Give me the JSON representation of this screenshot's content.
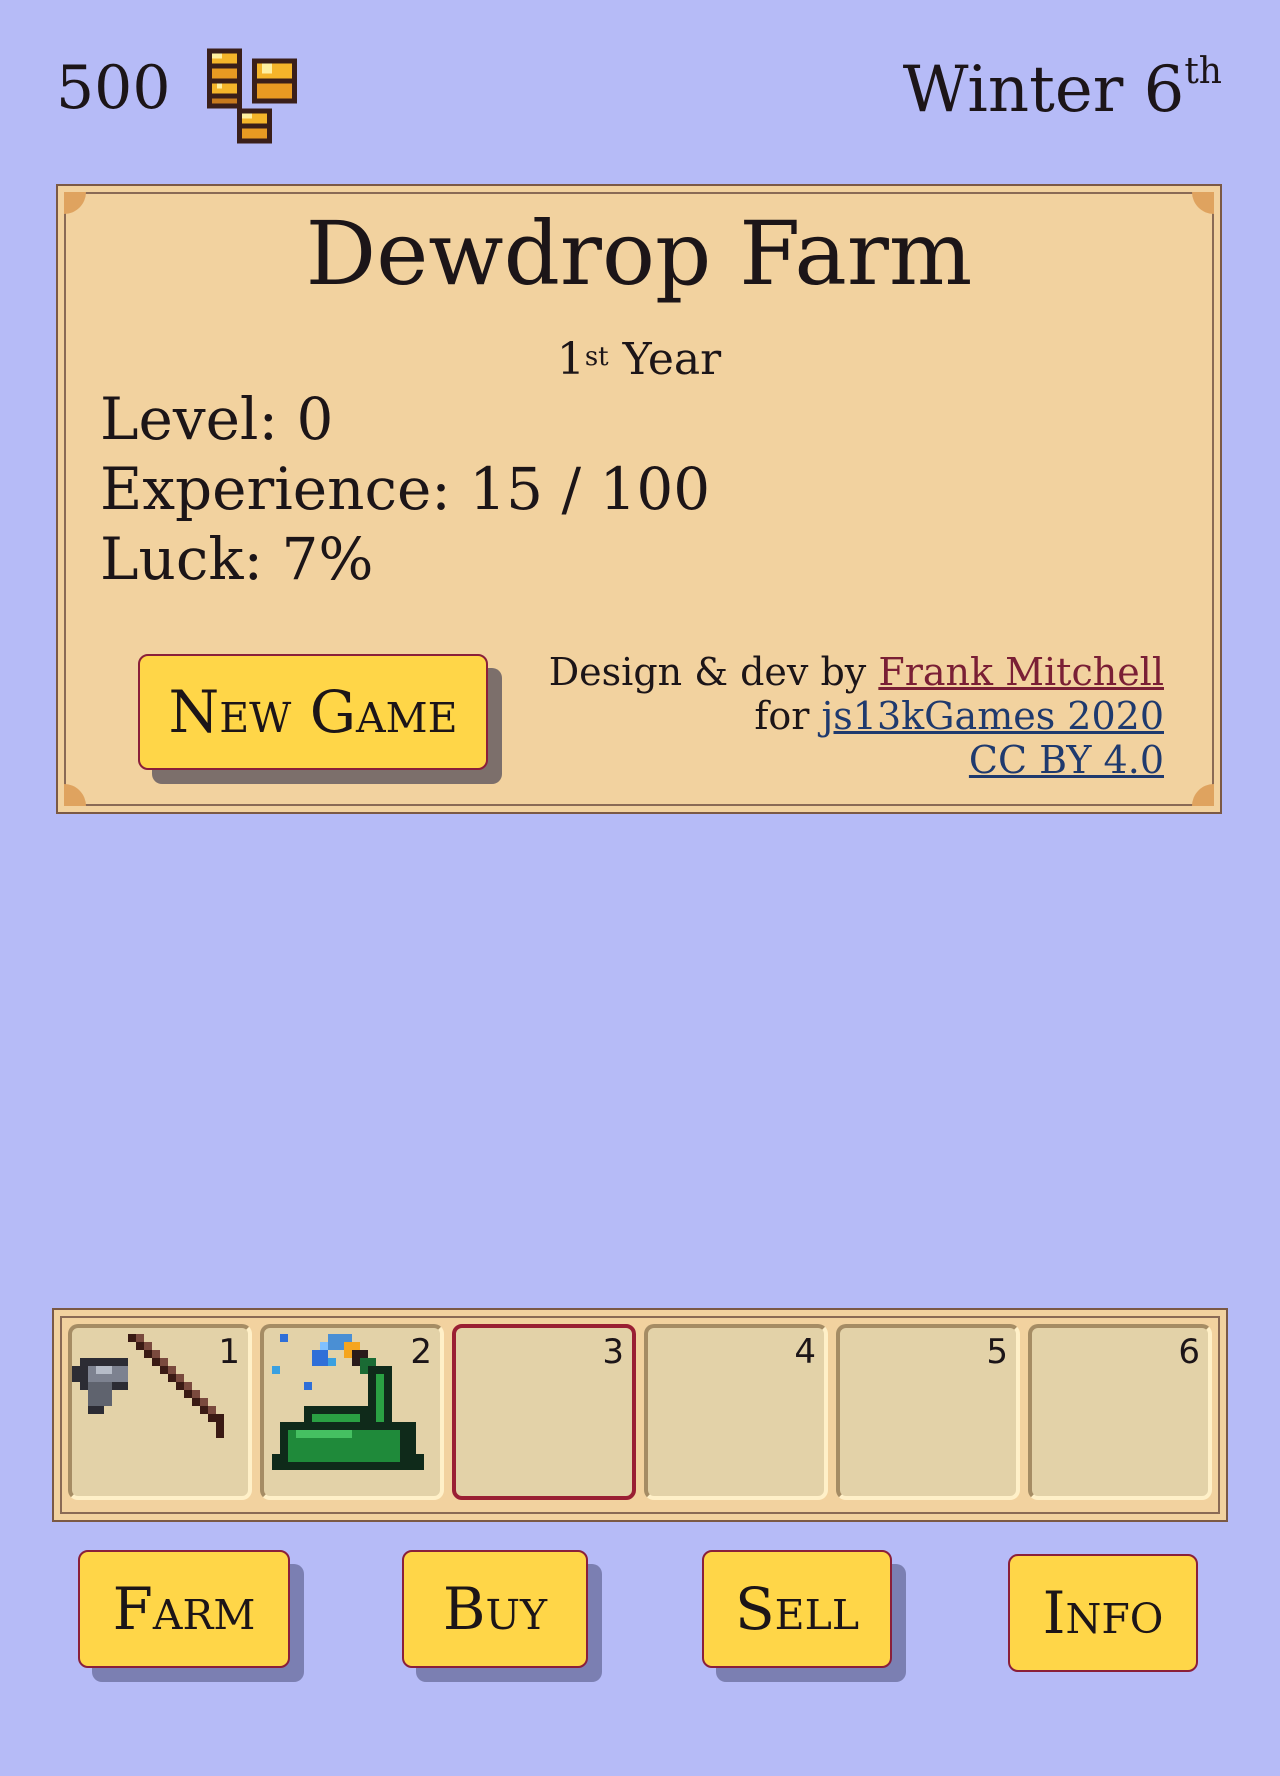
{
  "hud": {
    "gold": "500",
    "season_day": "Winter 6",
    "season_day_suffix": "th"
  },
  "farm_panel": {
    "title": "Dewdrop Farm",
    "year_number": "1",
    "year_suffix": "st",
    "year_label": " Year",
    "level": "Level: 0",
    "experience": "Experience: 15 / 100",
    "luck": "Luck: 7%",
    "new_game_label": "New Game",
    "credits": {
      "prefix": "Design & dev by ",
      "author": "Frank Mitchell",
      "for_prefix": "for ",
      "event": "js13kGames 2020",
      "license": "CC BY 4.0"
    }
  },
  "toolbar": {
    "slots": [
      {
        "number": "1",
        "item": "hoe-icon"
      },
      {
        "number": "2",
        "item": "watering-can-icon"
      },
      {
        "number": "3",
        "item": "",
        "selected": true
      },
      {
        "number": "4",
        "item": ""
      },
      {
        "number": "5",
        "item": ""
      },
      {
        "number": "6",
        "item": ""
      }
    ]
  },
  "nav": {
    "farm": "Farm",
    "buy": "Buy",
    "sell": "Sell",
    "info": "Info"
  },
  "colors": {
    "background": "#b6bbf7",
    "panel": "#f2d29f",
    "button": "#ffd648",
    "button_border": "#8a1f3a",
    "selected_slot": "#9a1f33"
  }
}
